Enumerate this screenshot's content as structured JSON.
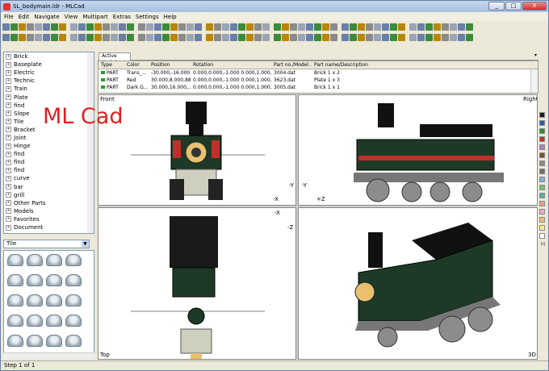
{
  "window": {
    "title": "SL_bodymain.ldr - MLCad",
    "minimize": "_",
    "maximize": "□",
    "close": "X"
  },
  "menu": [
    "File",
    "Edit",
    "Navigate",
    "View",
    "Multipart",
    "Extras",
    "Settings",
    "Help"
  ],
  "tree": [
    "Brick",
    "Baseplate",
    "Electric",
    "Technic",
    "Train",
    "Plate",
    "find",
    "Slope",
    "Tile",
    "Bracket",
    "Joint",
    "Hinge",
    "find",
    "find",
    "find",
    "curve",
    "bar",
    "grill",
    "Other Parts",
    "Models",
    "Favorites",
    "Document"
  ],
  "parts_category": "Tile",
  "model_tab": "Active Model",
  "table": {
    "headers": [
      "Type",
      "Color",
      "Position",
      "Rotation",
      "Part no./Model ...",
      "Part name/Description"
    ],
    "rows": [
      [
        "PART",
        "Trans_...",
        "-30.000,-16.000,...",
        "0.000,0.000,-1.000 0.000,1.000,0.000,...",
        "3004.dat",
        "Brick  1 x 2"
      ],
      [
        "PART",
        "Red",
        "30.000,8.000,88...",
        "0.000,0.000,-1.000 0.000,1.000,0.000,...",
        "3623.dat",
        "Plate  1 x 3"
      ],
      [
        "PART",
        "Dark G...",
        "30.000,16.000,...",
        "0.000,0.000,-1.000 0.000,1.000,0.000,...",
        "3005.dat",
        "Brick  1 x 1"
      ]
    ]
  },
  "viewports": {
    "front": "Front",
    "right": "Right",
    "top": "Top",
    "three_d": "3D"
  },
  "axes": {
    "front": [
      "-Y",
      "-X",
      "+Z"
    ],
    "right": [
      "-Y",
      "+Z"
    ],
    "top": [
      "-X",
      "-Z"
    ]
  },
  "palette": [
    "#1a1a1a",
    "#2a5ea8",
    "#2e8b3e",
    "#c0302b",
    "#b47ec0",
    "#7a5230",
    "#8c8c8c",
    "#6d6d6d",
    "#7fb0e0",
    "#76c06e",
    "#54b0b0",
    "#f09a8a",
    "#e8a8d0",
    "#e8c070",
    "#f6ef8a",
    "#ffffff"
  ],
  "palette_more": "M",
  "status": "Step 1 of 1",
  "overlay": "ML Cad"
}
